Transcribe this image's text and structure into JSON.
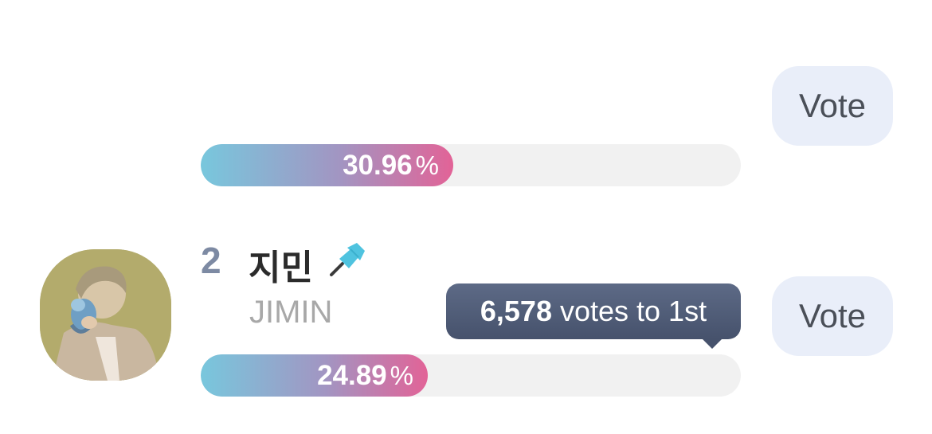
{
  "top_entry": {
    "vote_label": "Vote",
    "percent": "30.96",
    "percent_unit": "%",
    "fill_fraction": 0.4676
  },
  "entry": {
    "rank": "2",
    "name_ko": "지민",
    "name_en": "JIMIN",
    "pin_icon": "pushpin-icon",
    "pin_color": "#4fc3df",
    "vote_label": "Vote",
    "percent": "24.89",
    "percent_unit": "%",
    "fill_fraction": 0.4204,
    "tooltip": {
      "votes": "6,578",
      "suffix": "votes to 1st"
    }
  },
  "colors": {
    "gradient_start": "#78c7dd",
    "gradient_end": "#e26397",
    "vote_button_bg": "#e9eef9",
    "tooltip_bg": "#4e5a75"
  }
}
